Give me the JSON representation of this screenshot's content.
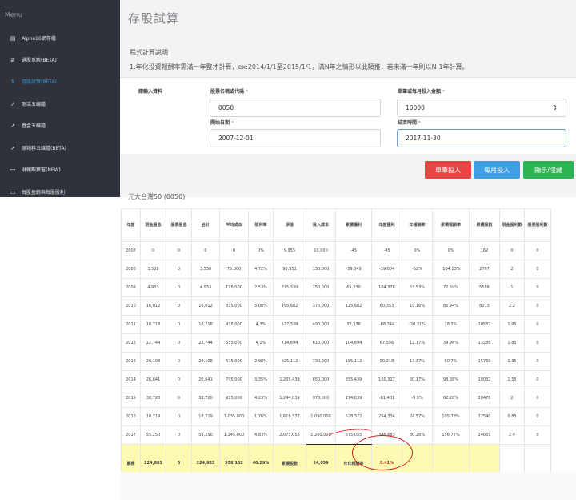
{
  "sidebar": {
    "menu_label": "Menu",
    "items": [
      {
        "label": "Alpha16網存檔",
        "icon": "database-icon"
      },
      {
        "label": "選股系統(BETA)",
        "icon": "filter-icon"
      },
      {
        "label": "存股試算(BETA)",
        "icon": "dollar-icon",
        "active": true
      },
      {
        "label": "剛活五線譜",
        "icon": "line-chart-icon"
      },
      {
        "label": "基金五線譜",
        "icon": "line-chart-icon"
      },
      {
        "label": "原物料五線譜(BETA)",
        "icon": "line-chart-icon"
      },
      {
        "label": "財報觀察窗(NEW)",
        "icon": "folder-icon"
      },
      {
        "label": "每股盈餘與每股股利",
        "icon": "folder-icon"
      }
    ]
  },
  "page": {
    "title": "存股試算",
    "calc_label": "程式計算說明",
    "calc_note": "1.年化投資報酬率需滿一年整才計算，ex:2014/1/1至2015/1/1，滿N年之情形以此類推，若未滿一年則以N-1年計算。"
  },
  "form": {
    "section_label": "請輸入資料",
    "stock_label": "股票名稱或代碼",
    "stock_value": "0050",
    "amount_label": "單筆或每月投入金額",
    "amount_value": "10000",
    "start_label": "開始日期",
    "start_value": "2007-12-01",
    "end_label": "結束時間",
    "end_value": "2017-11-30",
    "required_mark": "*"
  },
  "buttons": {
    "single": "單筆投入",
    "monthly": "每月投入",
    "toggle": "顯示/隱藏"
  },
  "colors": {
    "red": "#e84545",
    "blue": "#3da0e3",
    "green": "#2ab552",
    "sidebar": "#2f323a"
  },
  "result": {
    "stock_name": "元大台灣50 (0050)",
    "headers": [
      "年度",
      "現金股息",
      "股票股息",
      "合計",
      "平均成本",
      "殖利率",
      "淨值",
      "投入成本",
      "累積獲利",
      "年度獲利",
      "年報酬率",
      "累積報酬率",
      "累積股數",
      "現金股利數",
      "股票股利數"
    ],
    "rows": [
      [
        "2007",
        "0",
        "0",
        "0",
        "0",
        "0%",
        "9,955",
        "10,000",
        "-45",
        "-45",
        "0%",
        "0%",
        "162",
        "0",
        "0"
      ],
      [
        "2008",
        "3,538",
        "0",
        "3,538",
        "75,000",
        "4.72%",
        "90,951",
        "130,000",
        "-39,049",
        "-39,004",
        "-52%",
        "-104.13%",
        "2767",
        "2",
        "0"
      ],
      [
        "2009",
        "4,933",
        "0",
        "4,933",
        "195,000",
        "2.53%",
        "315,330",
        "250,000",
        "65,330",
        "104,378",
        "53.53%",
        "72.59%",
        "5586",
        "1",
        "0"
      ],
      [
        "2010",
        "16,012",
        "0",
        "16,012",
        "315,000",
        "5.08%",
        "495,682",
        "370,000",
        "125,682",
        "60,353",
        "19.16%",
        "85.94%",
        "8073",
        "2.2",
        "0"
      ],
      [
        "2011",
        "18,718",
        "0",
        "18,718",
        "435,000",
        "4.3%",
        "527,338",
        "490,000",
        "37,338",
        "-88,344",
        "-20.31%",
        "18.3%",
        "10587",
        "1.95",
        "0"
      ],
      [
        "2012",
        "22,744",
        "0",
        "22,744",
        "555,000",
        "4.1%",
        "714,894",
        "610,000",
        "104,894",
        "67,556",
        "12.17%",
        "39.96%",
        "13288",
        "1.85",
        "0"
      ],
      [
        "2013",
        "20,108",
        "0",
        "20,108",
        "675,000",
        "2.98%",
        "925,112",
        "730,000",
        "195,112",
        "90,218",
        "13.37%",
        "60.7%",
        "15760",
        "1.35",
        "0"
      ],
      [
        "2014",
        "26,641",
        "0",
        "26,641",
        "795,000",
        "3.35%",
        "1,205,439",
        "850,000",
        "355,439",
        "160,327",
        "20.17%",
        "93.38%",
        "18032",
        "1.55",
        "0"
      ],
      [
        "2015",
        "38,720",
        "0",
        "38,720",
        "915,000",
        "4.23%",
        "1,244,039",
        "970,000",
        "274,039",
        "-81,401",
        "-9.9%",
        "62.28%",
        "20478",
        "2",
        "0"
      ],
      [
        "2016",
        "18,219",
        "0",
        "18,219",
        "1,035,000",
        "1.76%",
        "1,618,372",
        "1,090,000",
        "528,372",
        "254,334",
        "24.57%",
        "105.78%",
        "22540",
        "0.85",
        "0"
      ],
      [
        "2017",
        "55,250",
        "0",
        "55,250",
        "1,145,000",
        "4.83%",
        "2,075,055",
        "1,200,000",
        "875,055",
        "346,683",
        "30.28%",
        "156.77%",
        "24659",
        "2.4",
        "0"
      ]
    ],
    "summary": {
      "label": "累積",
      "cash_div": "224,883",
      "stock_div": "0",
      "total": "224,883",
      "avg_cost": "558,182",
      "yield": "40.29%",
      "shares_label": "累積股數",
      "shares": "24,659",
      "annual_label": "年化報酬率",
      "annual": "9.41%"
    }
  }
}
